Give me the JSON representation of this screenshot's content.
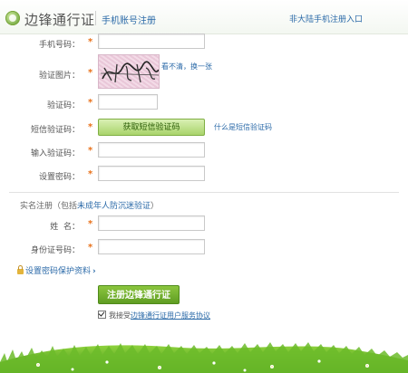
{
  "header": {
    "logo_text": "边锋通行证",
    "subtitle": "手机账号注册",
    "overseas_link": "非大陆手机注册入口"
  },
  "form": {
    "phone_label": "手机号码：",
    "captcha_image_label": "验证图片：",
    "captcha_refresh": "看不清，换一张",
    "captcha_code_label": "验证码：",
    "sms_code_label": "短信验证码：",
    "sms_button": "获取短信验证码",
    "sms_help_link": "什么是短信验证码",
    "enter_code_label": "输入验证码：",
    "password_label": "设置密码：",
    "required_mark": "*"
  },
  "realname": {
    "title_prefix": "实名注册（包括",
    "title_highlight": "未成年人防沉迷验证",
    "title_suffix": "）",
    "name_label": "姓  名：",
    "id_label": "身份证号码："
  },
  "security_link": "设置密码保护资料",
  "submit_button": "注册边锋通行证",
  "agreement": {
    "prefix": "我接受",
    "link": "边锋通行证用户服务协议"
  }
}
